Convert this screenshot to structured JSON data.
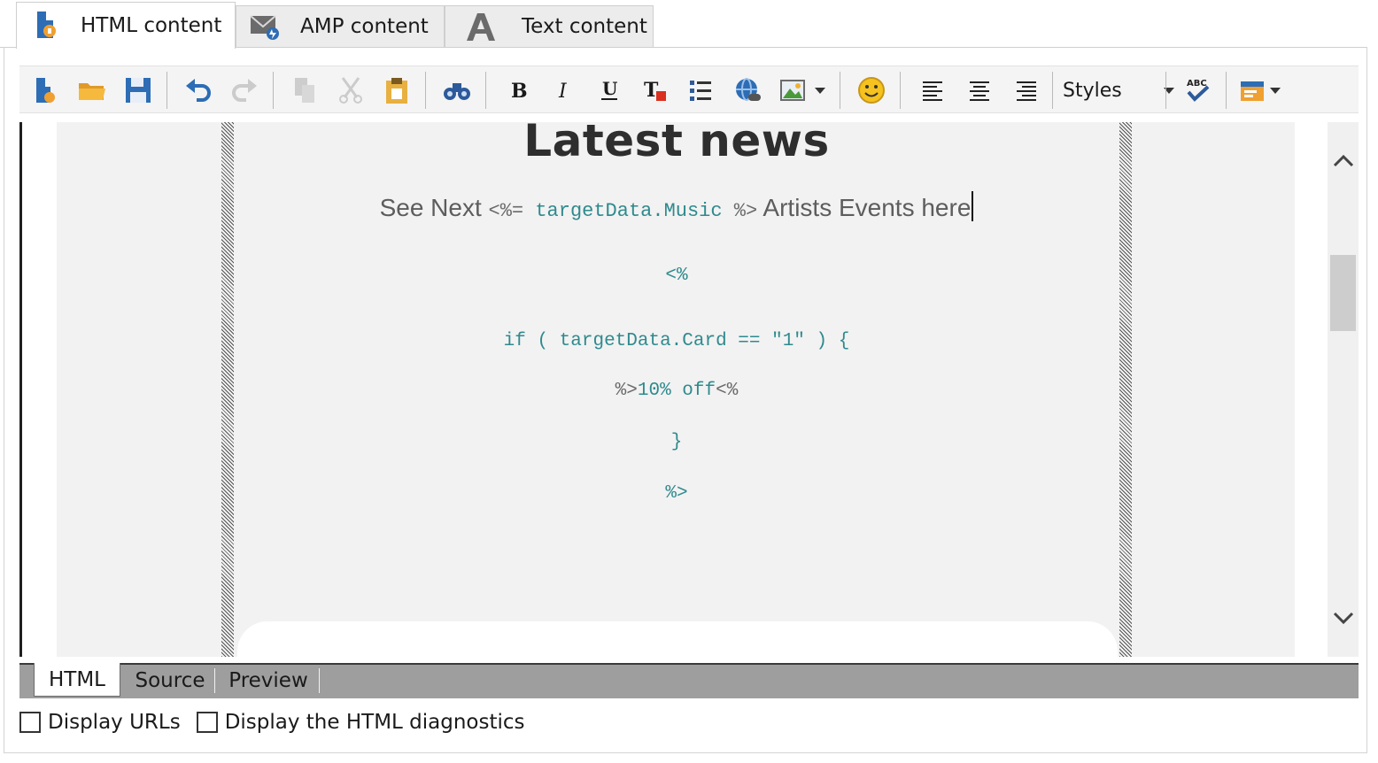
{
  "tabs": [
    {
      "label": "HTML content",
      "icon": "html-document-icon",
      "active": true
    },
    {
      "label": "AMP content",
      "icon": "amp-mail-icon",
      "active": false
    },
    {
      "label": "Text content",
      "icon": "letter-a-icon",
      "active": false
    }
  ],
  "toolbar": {
    "styles_label": "Styles",
    "buttons": [
      {
        "icon": "new-document-icon",
        "enabled": true
      },
      {
        "icon": "open-folder-icon",
        "enabled": true
      },
      {
        "icon": "save-icon",
        "enabled": true
      },
      {
        "icon": "undo-icon",
        "enabled": true
      },
      {
        "icon": "redo-icon",
        "enabled": false
      },
      {
        "icon": "copy-icon",
        "enabled": false
      },
      {
        "icon": "cut-icon",
        "enabled": false
      },
      {
        "icon": "paste-icon",
        "enabled": true
      },
      {
        "icon": "find-icon",
        "enabled": true
      },
      {
        "icon": "bold-icon",
        "enabled": true
      },
      {
        "icon": "italic-icon",
        "enabled": true
      },
      {
        "icon": "underline-icon",
        "enabled": true
      },
      {
        "icon": "clear-format-icon",
        "enabled": true
      },
      {
        "icon": "bulleted-list-icon",
        "enabled": true
      },
      {
        "icon": "insert-link-icon",
        "enabled": true
      },
      {
        "icon": "insert-image-icon",
        "enabled": true
      },
      {
        "icon": "emoticon-icon",
        "enabled": true
      },
      {
        "icon": "align-left-icon",
        "enabled": true
      },
      {
        "icon": "align-center-icon",
        "enabled": true
      },
      {
        "icon": "align-right-icon",
        "enabled": true
      },
      {
        "icon": "spell-check-icon",
        "enabled": true
      },
      {
        "icon": "insert-block-icon",
        "enabled": true
      }
    ]
  },
  "editor": {
    "headline": "Latest news",
    "subline_before": "See Next ",
    "subline_code_open": "<%=",
    "subline_code_expr": " targetData.Music ",
    "subline_code_close": "%>",
    "subline_after": " Artists Events here",
    "code_lines": {
      "open": "<%",
      "if_line": "if ( targetData.Card == \"1\" ) {",
      "offer_close": "%>",
      "offer_text": "10% off",
      "offer_open": "<%",
      "brace": "}",
      "close": "%>"
    }
  },
  "bottom_tabs": [
    {
      "label": "HTML",
      "active": true
    },
    {
      "label": "Source",
      "active": false
    },
    {
      "label": "Preview",
      "active": false
    }
  ],
  "options": {
    "display_urls": {
      "label": "Display URLs",
      "checked": false
    },
    "display_diagnostics": {
      "label": "Display the HTML diagnostics",
      "checked": false
    }
  }
}
